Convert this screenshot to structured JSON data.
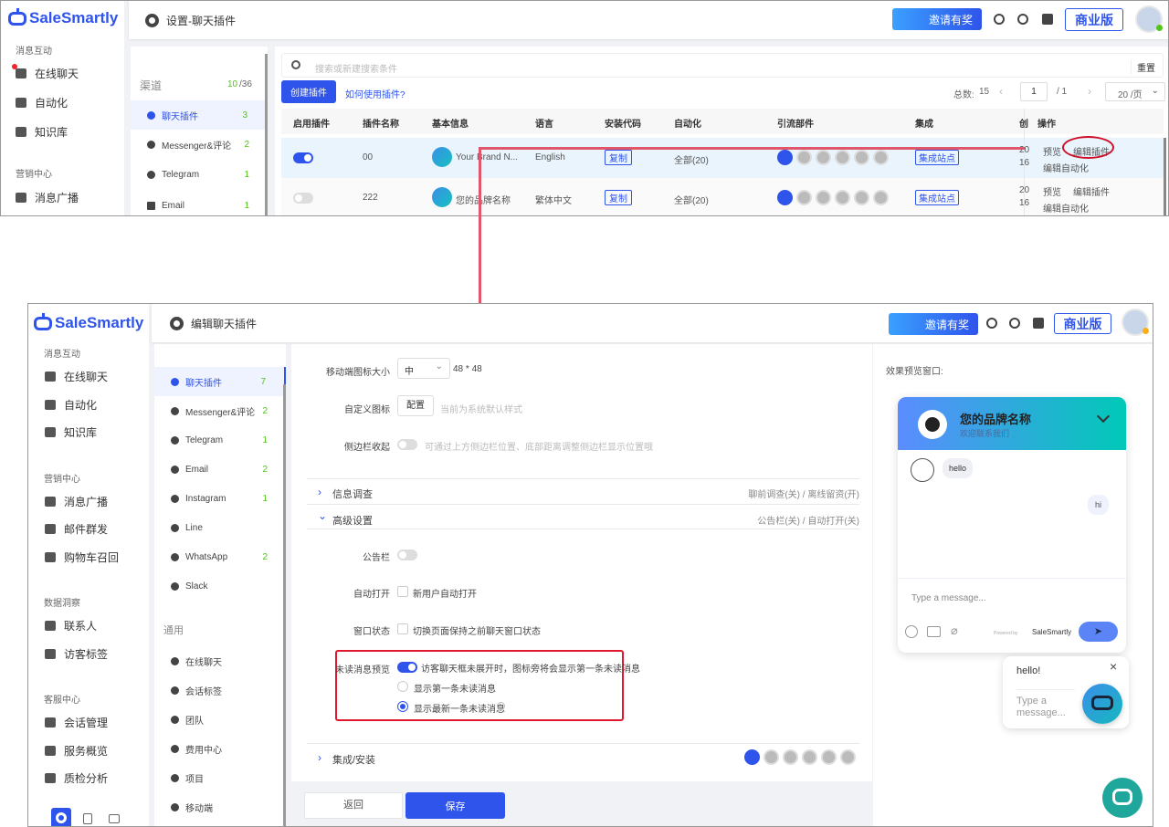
{
  "brand": "SaleSmartly",
  "top": {
    "header_title": "设置-聊天插件",
    "invite": "邀请有奖",
    "edition": "商业版",
    "sidebar": {
      "sections": [
        {
          "title": "消息互动",
          "items": [
            "在线聊天",
            "自动化",
            "知识库"
          ]
        },
        {
          "title": "营销中心",
          "items": [
            "消息广播"
          ]
        }
      ]
    },
    "channels": {
      "title": "渠道",
      "used": "10",
      "total": "/36",
      "items": [
        {
          "label": "聊天插件",
          "count": "3"
        },
        {
          "label": "Messenger&评论",
          "count": "2"
        },
        {
          "label": "Telegram",
          "count": "1"
        },
        {
          "label": "Email",
          "count": "1"
        }
      ]
    },
    "search_placeholder": "搜索或新建搜索条件",
    "reset": "重置",
    "create": "创建插件",
    "howto": "如何使用插件?",
    "total_label": "总数:",
    "total": "15",
    "page": "1",
    "pages": "/ 1",
    "per_page": "20 /页",
    "columns": [
      "启用插件",
      "插件名称",
      "基本信息",
      "语言",
      "安装代码",
      "自动化",
      "引流部件",
      "集成",
      "创",
      "操作"
    ],
    "rows": [
      {
        "enabled": true,
        "name": "00",
        "info": "Your Brand N...",
        "lang": "English",
        "code": "复制",
        "auto": "全部(20)",
        "integ": "集成站点",
        "created1": "20",
        "created2": "16",
        "preview": "预览",
        "edit": "编辑插件",
        "edit_auto": "编辑自动化"
      },
      {
        "enabled": false,
        "name": "222",
        "info": "您的品牌名称",
        "lang": "繁体中文",
        "code": "复制",
        "auto": "全部(20)",
        "integ": "集成站点",
        "created1": "20",
        "created2": "16",
        "preview": "预览",
        "edit": "编辑插件",
        "edit_auto": "编辑自动化"
      }
    ]
  },
  "bottom": {
    "header_title": "编辑聊天插件",
    "invite": "邀请有奖",
    "edition": "商业版",
    "sidebar": [
      {
        "title": "消息互动",
        "items": [
          "在线聊天",
          "自动化",
          "知识库"
        ]
      },
      {
        "title": "营销中心",
        "items": [
          "消息广播",
          "邮件群发",
          "购物车召回"
        ]
      },
      {
        "title": "数据洞察",
        "items": [
          "联系人",
          "访客标签"
        ]
      },
      {
        "title": "客服中心",
        "items": [
          "会话管理",
          "服务概览",
          "质检分析"
        ]
      }
    ],
    "channels": [
      {
        "label": "聊天插件",
        "count": "7"
      },
      {
        "label": "Messenger&评论",
        "count": "2"
      },
      {
        "label": "Telegram",
        "count": "1"
      },
      {
        "label": "Email",
        "count": "2"
      },
      {
        "label": "Instagram",
        "count": "1"
      },
      {
        "label": "Line",
        "count": ""
      },
      {
        "label": "WhatsApp",
        "count": "2"
      },
      {
        "label": "Slack",
        "count": ""
      }
    ],
    "general_title": "通用",
    "general": [
      "在线聊天",
      "会话标签",
      "团队",
      "费用中心",
      "项目",
      "移动端"
    ],
    "form": {
      "icon_size_label": "移动端图标大小",
      "icon_size_value": "中",
      "icon_size_dim": "48 * 48",
      "custom_icon_label": "自定义图标",
      "custom_icon_btn": "配置",
      "custom_icon_hint": "当前为系统默认样式",
      "sidebar_collapse_label": "侧边栏收起",
      "sidebar_collapse_hint": "可通过上方侧边栏位置、底部距离调整侧边栏显示位置哦",
      "survey_title": "信息调查",
      "survey_summary": "聊前调查(关) / 离线留资(开)",
      "advanced_title": "高级设置",
      "advanced_summary": "公告栏(关) / 自动打开(关)",
      "notice_label": "公告栏",
      "auto_open_label": "自动打开",
      "auto_open_text": "新用户自动打开",
      "window_state_label": "窗口状态",
      "window_state_text": "切换页面保持之前聊天窗口状态",
      "unread_label": "未读消息预览",
      "unread_text": "访客聊天框未展开时，图标旁将会显示第一条未读消息",
      "unread_opt1": "显示第一条未读消息",
      "unread_opt2": "显示最新一条未读消息",
      "integration_title": "集成/安装"
    },
    "back": "返回",
    "save": "保存",
    "preview": {
      "title": "效果预览窗口:",
      "brand": "您的品牌名称",
      "welcome": "欢迎联系我们",
      "msg_in": "hello",
      "msg_out": "hi",
      "placeholder": "Type a message...",
      "powered": "Powered by",
      "powered_brand": "SaleSmartly",
      "bubble_msg": "hello!",
      "bubble_placeholder": "Type a message..."
    }
  },
  "colors": {
    "accent": "#2f54eb",
    "highlight": "#e0182d",
    "gradient_start": "#5b8cff",
    "gradient_end": "#00c9b7"
  }
}
